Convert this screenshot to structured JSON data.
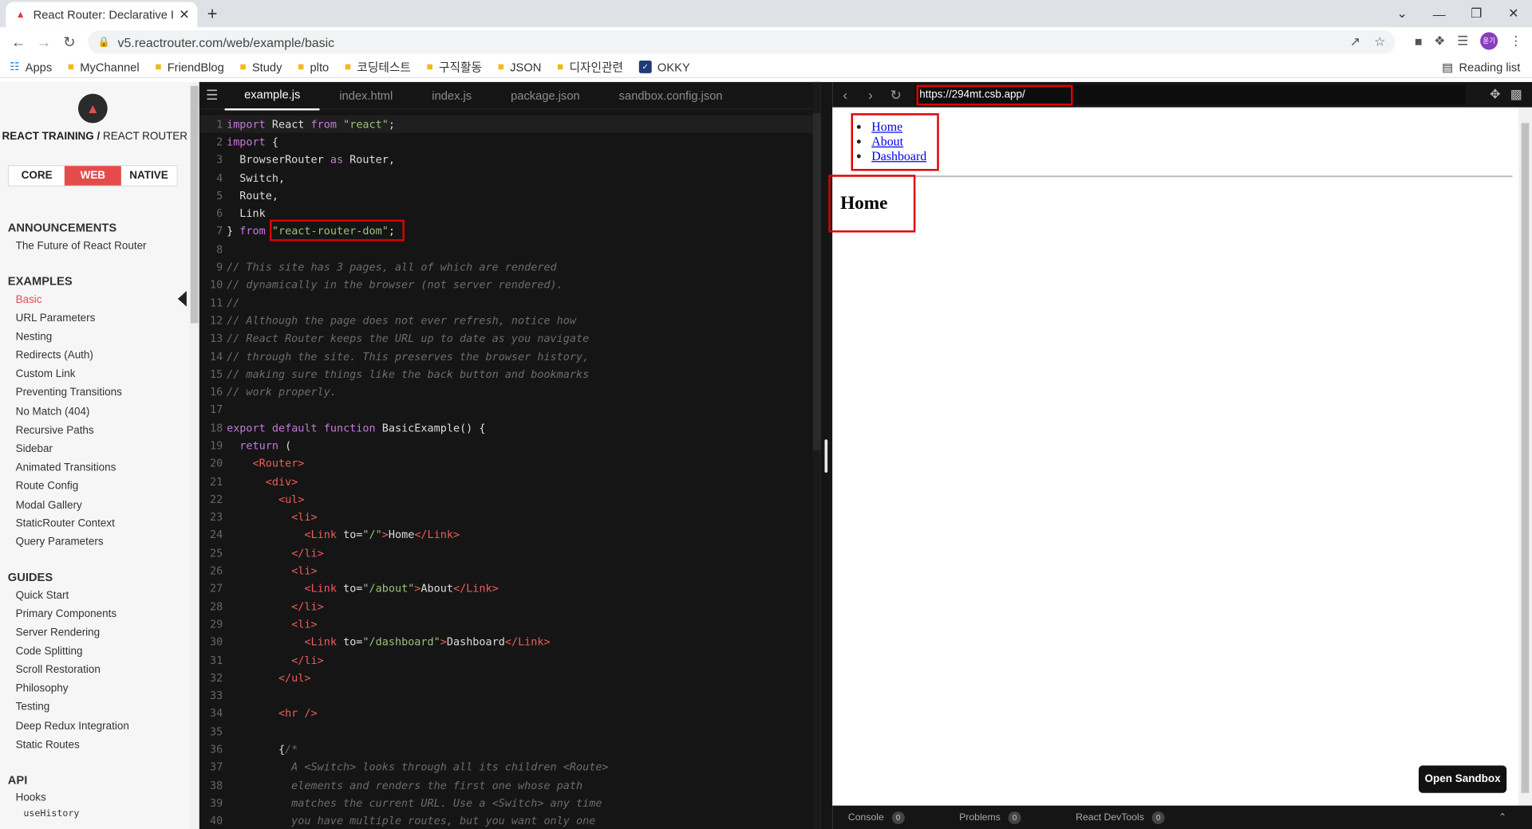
{
  "browser": {
    "tab_title": "React Router: Declarative Routin",
    "url": "v5.reactrouter.com/web/example/basic",
    "avatar_text": "윤기",
    "bookmarks": [
      "Apps",
      "MyChannel",
      "FriendBlog",
      "Study",
      "plto",
      "코딩테스트",
      "구직활동",
      "JSON",
      "디자인관련",
      "OKKY"
    ],
    "reading_list": "Reading list"
  },
  "sidebar": {
    "brand": "REACT TRAINING",
    "brand_sub": "REACT ROUTER",
    "platforms": [
      "CORE",
      "WEB",
      "NATIVE"
    ],
    "active_platform": "WEB",
    "sections": {
      "announcements": {
        "title": "ANNOUNCEMENTS",
        "items": [
          "The Future of React Router"
        ]
      },
      "examples": {
        "title": "EXAMPLES",
        "items": [
          "Basic",
          "URL Parameters",
          "Nesting",
          "Redirects (Auth)",
          "Custom Link",
          "Preventing Transitions",
          "No Match (404)",
          "Recursive Paths",
          "Sidebar",
          "Animated Transitions",
          "Route Config",
          "Modal Gallery",
          "StaticRouter Context",
          "Query Parameters"
        ]
      },
      "guides": {
        "title": "GUIDES",
        "items": [
          "Quick Start",
          "Primary Components",
          "Server Rendering",
          "Code Splitting",
          "Scroll Restoration",
          "Philosophy",
          "Testing",
          "Deep Redux Integration",
          "Static Routes"
        ]
      },
      "api": {
        "title": "API",
        "items": [
          "Hooks",
          "useHistory"
        ]
      }
    }
  },
  "editor": {
    "tabs": [
      "example.js",
      "index.html",
      "index.js",
      "package.json",
      "sandbox.config.json"
    ],
    "active_tab": "example.js",
    "lines": [
      "import React from \"react\";",
      "import {",
      "  BrowserRouter as Router,",
      "  Switch,",
      "  Route,",
      "  Link",
      "} from \"react-router-dom\";",
      "",
      "// This site has 3 pages, all of which are rendered",
      "// dynamically in the browser (not server rendered).",
      "//",
      "// Although the page does not ever refresh, notice how",
      "// React Router keeps the URL up to date as you navigate",
      "// through the site. This preserves the browser history,",
      "// making sure things like the back button and bookmarks",
      "// work properly.",
      "",
      "export default function BasicExample() {",
      "  return (",
      "    <Router>",
      "      <div>",
      "        <ul>",
      "          <li>",
      "            <Link to=\"/\">Home</Link>",
      "          </li>",
      "          <li>",
      "            <Link to=\"/about\">About</Link>",
      "          </li>",
      "          <li>",
      "            <Link to=\"/dashboard\">Dashboard</Link>",
      "          </li>",
      "        </ul>",
      "",
      "        <hr />",
      "",
      "        {/*",
      "          A <Switch> looks through all its children <Route>",
      "          elements and renders the first one whose path",
      "          matches the current URL. Use a <Switch> any time",
      "          you have multiple routes, but you want only one"
    ]
  },
  "preview": {
    "url": "https://294mt.csb.app/",
    "links": [
      "Home",
      "About",
      "Dashboard"
    ],
    "heading": "Home",
    "open_sandbox": "Open Sandbox",
    "devtools": [
      {
        "label": "Console",
        "count": "0"
      },
      {
        "label": "Problems",
        "count": "0"
      },
      {
        "label": "React DevTools",
        "count": "0"
      }
    ]
  },
  "colors": {
    "accent": "#e54b4b",
    "highlight": "#e00000",
    "editor_bg": "#151515"
  }
}
